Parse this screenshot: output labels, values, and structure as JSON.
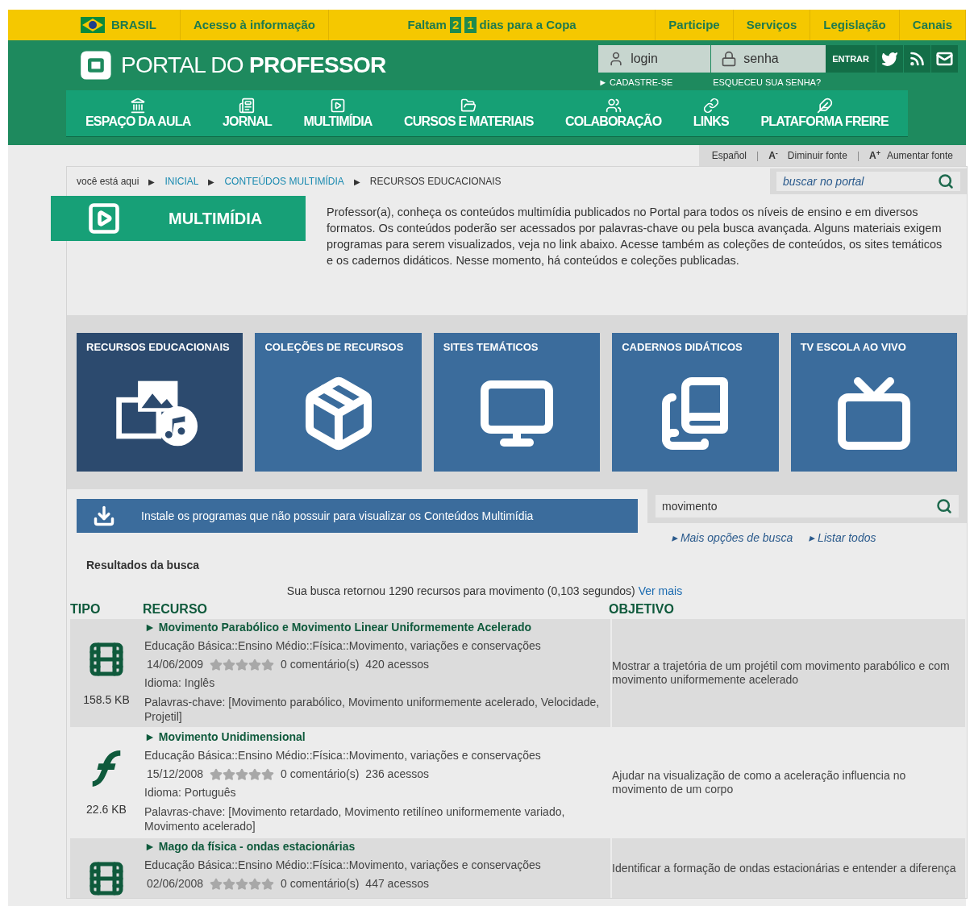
{
  "top_bar": {
    "country": "BRASIL",
    "access": "Acesso à informação",
    "countdown": {
      "prefix": "Faltam",
      "digits": [
        "2",
        "1"
      ],
      "suffix": "dias para a Copa"
    },
    "links": [
      "Participe",
      "Serviços",
      "Legislação",
      "Canais"
    ]
  },
  "header": {
    "logo_light": "PORTAL DO",
    "logo_bold": "PROFESSOR",
    "login_placeholder": "login",
    "password_placeholder": "senha",
    "enter": "ENTRAR",
    "register": "► CADASTRE-SE",
    "forgot": "ESQUECEU SUA SENHA?"
  },
  "nav": [
    {
      "kind": "bank",
      "label": "ESPAÇO DA AULA"
    },
    {
      "kind": "newspaper",
      "label": "JORNAL"
    },
    {
      "kind": "play",
      "label": "MULTIMÍDIA"
    },
    {
      "kind": "folder",
      "label": "CURSOS E MATERIAIS"
    },
    {
      "kind": "users",
      "label": "COLABORAÇÃO"
    },
    {
      "kind": "link",
      "label": "LINKS"
    },
    {
      "kind": "feather",
      "label": "PLATAFORMA FREIRE"
    }
  ],
  "tools": {
    "separator": "|",
    "language": "Español",
    "decrease_mark": "A",
    "decrease_sup": "-",
    "decrease": "Diminuir fonte",
    "increase_mark": "A",
    "increase_sup": "+",
    "increase": "Aumentar fonte"
  },
  "breadcrumb": {
    "intro": "você está aqui",
    "separator": "▶",
    "items": [
      {
        "label": "INICIAL",
        "link": true
      },
      {
        "label": "CONTEÚDOS MULTIMÍDIA",
        "link": true
      },
      {
        "label": "RECURSOS EDUCACIONAIS",
        "link": false
      }
    ]
  },
  "portal_search": {
    "placeholder": "buscar no portal"
  },
  "section": {
    "title": "MULTIMÍDIA",
    "intro": "Professor(a), conheça os conteúdos multimídia publicados no Portal para todos os níveis de ensino e em diversos formatos. Os conteúdos poderão ser acessados por palavras-chave ou pela busca avançada. Alguns materiais exigem programas para serem visualizados, veja no link abaixo. Acesse também as coleções de conteúdos, os sites temáticos e os cadernos didáticos. Nesse momento, há conteúdos e coleções publicadas."
  },
  "tiles": [
    {
      "kind": "media",
      "label": "RECURSOS EDUCACIONAIS",
      "selected": true
    },
    {
      "kind": "box",
      "label": "COLEÇÕES DE RECURSOS",
      "selected": false
    },
    {
      "kind": "monitor",
      "label": "SITES TEMÁTICOS",
      "selected": false
    },
    {
      "kind": "books",
      "label": "CADERNOS DIDÁTICOS",
      "selected": false
    },
    {
      "kind": "tv",
      "label": "TV ESCOLA AO VIVO",
      "selected": false
    }
  ],
  "install_banner": "Instale os programas que não possuir para visualizar os Conteúdos Multimídia",
  "search": {
    "value": "movimento",
    "more_options": "▸ Mais opções de busca",
    "list_all": "▸ Listar todos"
  },
  "results": {
    "heading": "Resultados da busca",
    "summary": "Sua busca retornou 1290 recursos para movimento (0,103 segundos)",
    "more": "Ver mais",
    "columns": [
      "TIPO",
      "RECURSO",
      "OBJETIVO"
    ],
    "rows": [
      {
        "kind": "film",
        "size": "158.5 KB",
        "title": "► Movimento Parabólico e Movimento Linear Uniformemente Acelerado",
        "category": "Educação Básica::Ensino Médio::Física::Movimento, variações e conservações",
        "date": "14/06/2009",
        "stars": 0,
        "comments": "0 comentário(s)",
        "views": "420 acessos",
        "language": "Idioma: Inglês",
        "keywords": "Palavras-chave: [Movimento parabólico, Movimento uniformemente acelerado, Velocidade, Projetil]",
        "objective": "Mostrar a trajetória de um projétil com movimento parabólico e com movimento uniformemente acelerado"
      },
      {
        "kind": "flash",
        "size": "22.6 KB",
        "title": "► Movimento Unidimensional",
        "category": "Educação Básica::Ensino Médio::Física::Movimento, variações e conservações",
        "date": "15/12/2008",
        "stars": 0,
        "comments": "0 comentário(s)",
        "views": "236 acessos",
        "language": "Idioma: Português",
        "keywords": "Palavras-chave: [Movimento retardado, Movimento retilíneo uniformemente variado, Movimento acelerado]",
        "objective": "Ajudar na visualização de como a aceleração influencia no movimento de um corpo"
      },
      {
        "kind": "film",
        "title": "► Mago da física - ondas estacionárias",
        "category": "Educação Básica::Ensino Médio::Física::Movimento, variações e conservações",
        "date": "02/06/2008",
        "stars": 0,
        "comments": "0 comentário(s)",
        "views": "447 acessos",
        "objective": "Identificar a formação de ondas estacionárias e entender a diferença"
      }
    ]
  }
}
